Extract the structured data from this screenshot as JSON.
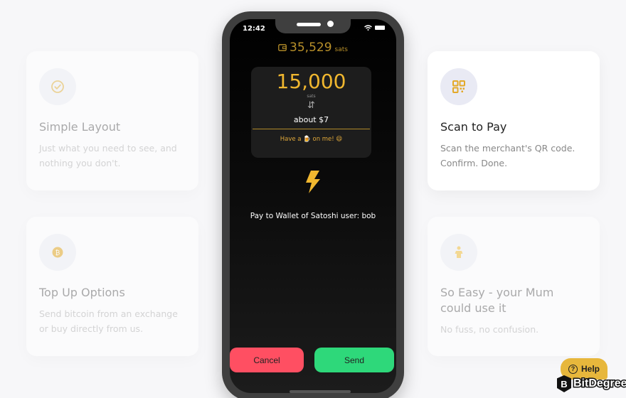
{
  "features": [
    {
      "id": "simple",
      "icon": "check-circle-icon",
      "title": "Simple Layout",
      "description": "Just what you need to see, and nothing you don't."
    },
    {
      "id": "scan",
      "icon": "qr-code-icon",
      "title": "Scan to Pay",
      "description": "Scan the merchant's QR code. Confirm. Done."
    },
    {
      "id": "topup",
      "icon": "bitcoin-coin-icon",
      "title": "Top Up Options",
      "description": "Send bitcoin from an exchange or buy directly from us."
    },
    {
      "id": "easy",
      "icon": "person-icon",
      "title": "So Easy - your Mum could use it",
      "description": "No fuss, no confusion."
    }
  ],
  "phone": {
    "status_time": "12:42",
    "balance": {
      "icon": "wallet-icon",
      "amount": "35,529",
      "unit": "sats"
    },
    "payment": {
      "amount": "15,000",
      "unit": "sats",
      "swap_glyph": "⇵",
      "fiat": "about $7",
      "memo": "Have a 🍺 on me! 😄"
    },
    "pay_to": "Pay to Wallet of Satoshi user: bob",
    "buttons": {
      "cancel": "Cancel",
      "send": "Send"
    }
  },
  "help": {
    "label": "Help",
    "glyph": "?"
  },
  "brand": {
    "name": "BitDegree",
    "glyph": "B"
  },
  "colors": {
    "accent": "#f0b72f",
    "cancel": "#ff4f62",
    "send": "#2ed87a",
    "help": "#e7b73c"
  }
}
